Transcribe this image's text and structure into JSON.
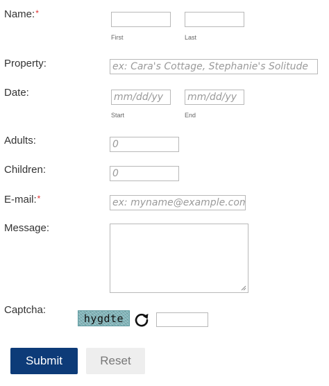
{
  "form": {
    "name": {
      "label": "Name:",
      "required_mark": "*",
      "first_label": "First",
      "last_label": "Last",
      "first_value": "",
      "last_value": ""
    },
    "property": {
      "label": "Property:",
      "placeholder": "ex: Cara's Cottage, Stephanie's Solitude"
    },
    "date": {
      "label": "Date:",
      "start_placeholder": "mm/dd/yy",
      "end_placeholder": "mm/dd/yy",
      "start_label": "Start",
      "end_label": "End"
    },
    "adults": {
      "label": "Adults:",
      "placeholder": "0"
    },
    "children": {
      "label": "Children:",
      "placeholder": "0"
    },
    "email": {
      "label": "E-mail:",
      "required_mark": "*",
      "placeholder": "ex: myname@example.com"
    },
    "message": {
      "label": "Message:",
      "value": ""
    },
    "captcha": {
      "label": "Captcha:",
      "image_text": "hygdte",
      "refresh_icon": "refresh-icon",
      "value": ""
    }
  },
  "buttons": {
    "submit": "Submit",
    "reset": "Reset"
  },
  "colors": {
    "required": "#e03030",
    "submit_bg": "#0d3b78",
    "reset_bg": "#eeeeee",
    "captcha_bg": "#7fb3b8"
  }
}
